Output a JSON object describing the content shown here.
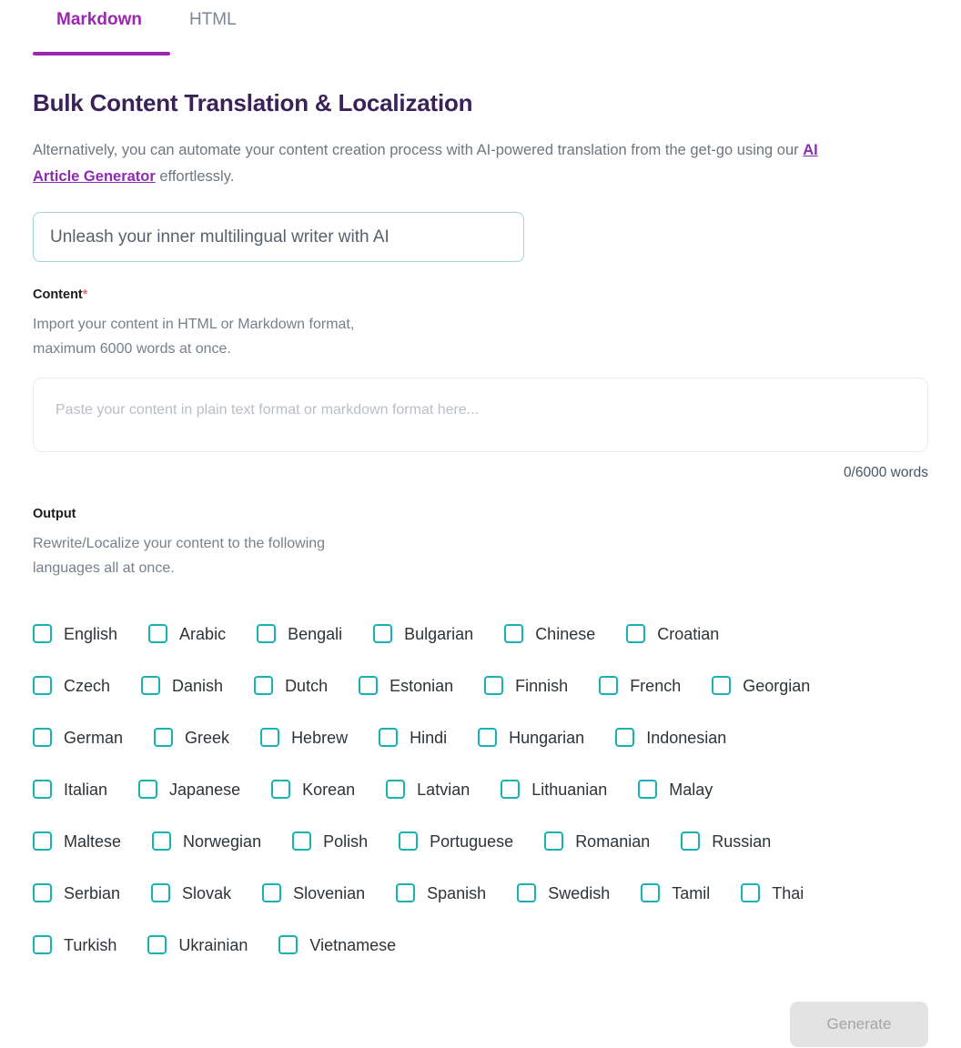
{
  "tabs": [
    {
      "label": "Markdown",
      "active": true
    },
    {
      "label": "HTML",
      "active": false
    }
  ],
  "heading": "Bulk Content Translation & Localization",
  "intro": {
    "before": "Alternatively, you can automate your content creation process with AI-powered translation from the get-go using our ",
    "link": "AI Article Generator",
    "after": " effortlessly."
  },
  "title_input": {
    "value": "Unleash your inner multilingual writer with AI",
    "placeholder": "Unleash your inner multilingual writer with AI"
  },
  "content": {
    "label": "Content",
    "required_mark": "*",
    "help": "Import your content in HTML or Markdown format,\nmaximum 6000 words at once.",
    "placeholder": "Paste your content in plain text format or markdown format here...",
    "value": "",
    "word_count": "0/6000 words"
  },
  "output": {
    "label": "Output",
    "help": "Rewrite/Localize your content to the following\nlanguages all at once."
  },
  "language_rows": [
    [
      "English",
      "Arabic",
      "Bengali",
      "Bulgarian",
      "Chinese",
      "Croatian"
    ],
    [
      "Czech",
      "Danish",
      "Dutch",
      "Estonian",
      "Finnish",
      "French",
      "Georgian"
    ],
    [
      "German",
      "Greek",
      "Hebrew",
      "Hindi",
      "Hungarian",
      "Indonesian"
    ],
    [
      "Italian",
      "Japanese",
      "Korean",
      "Latvian",
      "Lithuanian",
      "Malay"
    ],
    [
      "Maltese",
      "Norwegian",
      "Polish",
      "Portuguese",
      "Romanian",
      "Russian"
    ],
    [
      "Serbian",
      "Slovak",
      "Slovenian",
      "Spanish",
      "Swedish",
      "Tamil",
      "Thai"
    ],
    [
      "Turkish",
      "Ukrainian",
      "Vietnamese"
    ]
  ],
  "generate_button": {
    "label": "Generate",
    "disabled": true
  },
  "colors": {
    "accent_purple": "#9b27b0",
    "heading_purple": "#3b2159",
    "checkbox_teal": "#18b2b2",
    "link_purple": "#8f2bb4",
    "muted_text": "#6f767e",
    "disabled_button_bg": "#e3e3e3"
  }
}
